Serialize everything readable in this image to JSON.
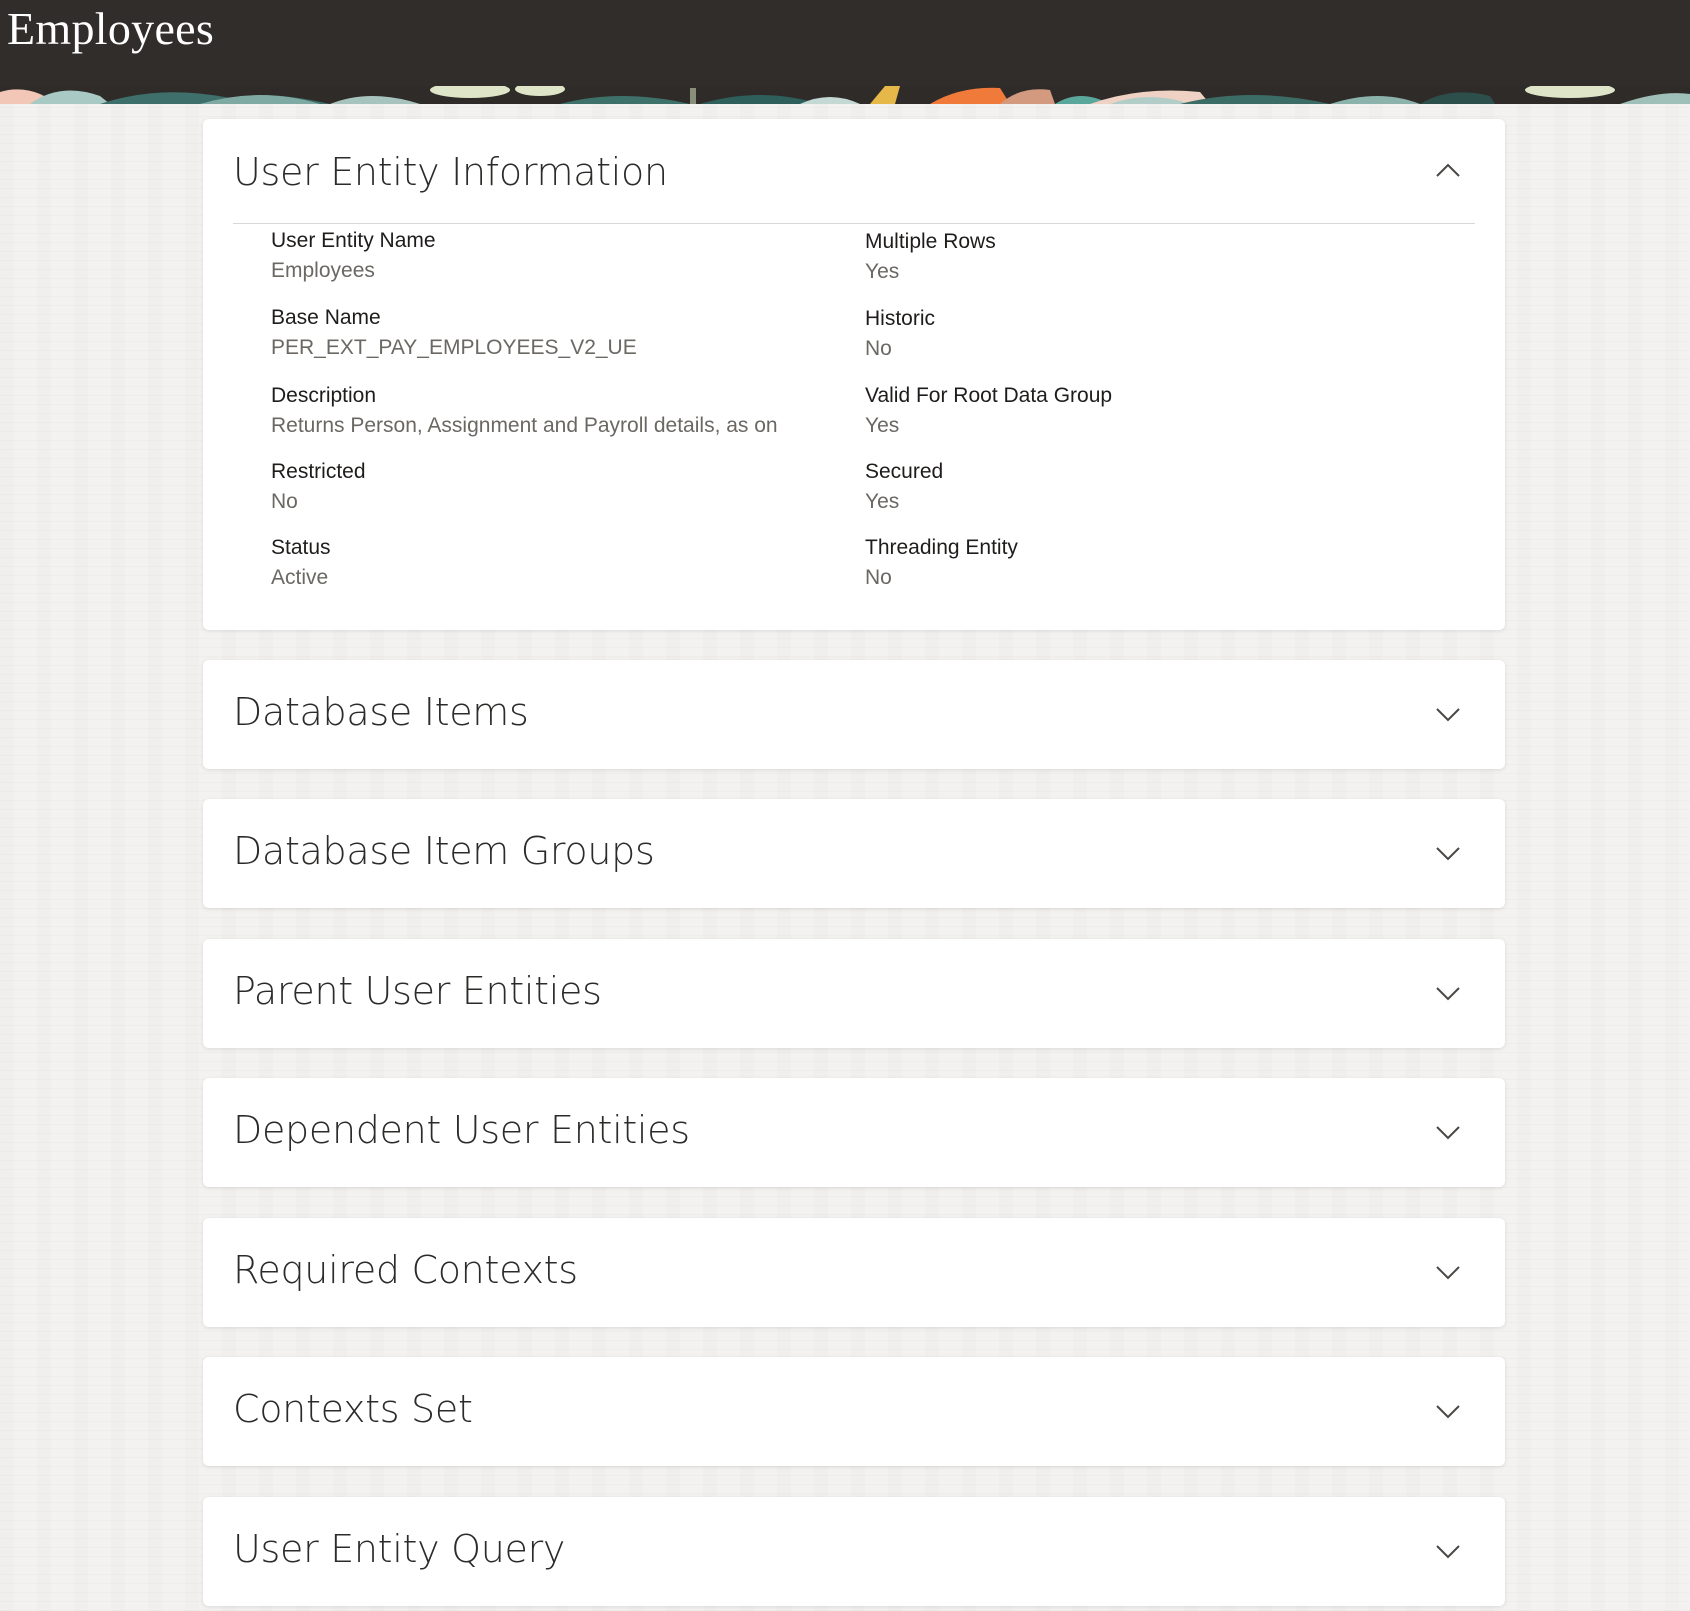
{
  "header": {
    "title": "Employees"
  },
  "info_panel": {
    "title": "User Entity Information",
    "left_fields": [
      {
        "label": "User Entity Name",
        "value": "Employees"
      },
      {
        "label": "Base Name",
        "value": "PER_EXT_PAY_EMPLOYEES_V2_UE"
      },
      {
        "label": "Description",
        "value": "Returns Person, Assignment and Payroll details, as on"
      },
      {
        "label": "Restricted",
        "value": "No"
      },
      {
        "label": "Status",
        "value": "Active"
      }
    ],
    "right_fields": [
      {
        "label": "Multiple Rows",
        "value": "Yes"
      },
      {
        "label": "Historic",
        "value": "No"
      },
      {
        "label": "Valid For Root Data Group",
        "value": "Yes"
      },
      {
        "label": "Secured",
        "value": "Yes"
      },
      {
        "label": "Threading Entity",
        "value": "No"
      }
    ]
  },
  "sections": [
    {
      "title": "Database Items"
    },
    {
      "title": "Database Item Groups"
    },
    {
      "title": "Parent User Entities"
    },
    {
      "title": "Dependent User Entities"
    },
    {
      "title": "Required Contexts"
    },
    {
      "title": "Contexts Set"
    },
    {
      "title": "User Entity Query"
    }
  ],
  "icons": {
    "expanded": "chevron-up-icon",
    "collapsed": "chevron-down-icon"
  }
}
